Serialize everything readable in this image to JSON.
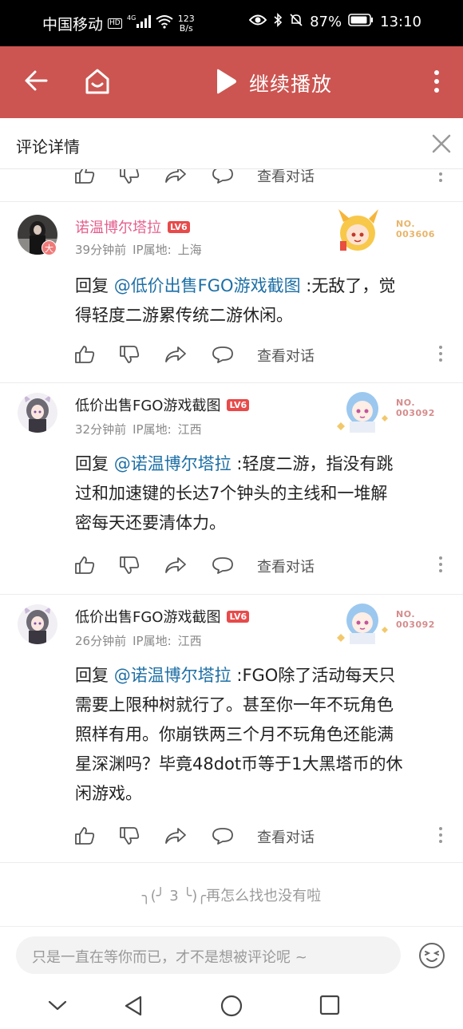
{
  "status_bar": {
    "carrier": "中国移动",
    "hd": "HD",
    "network": "4G",
    "speed_value": "123",
    "speed_unit": "B/s",
    "battery": "87%",
    "time": "13:10"
  },
  "app_bar": {
    "play_label": "继续播放"
  },
  "title_bar": {
    "title": "评论详情"
  },
  "action_label": "查看对话",
  "comments": [
    {
      "user": "诺温博尔塔拉",
      "level": "LV6",
      "badge": "大",
      "time": "39分钟前",
      "ip_label": "IP属地:",
      "ip": "上海",
      "deco_no": "NO.",
      "deco_num": "003606",
      "reply_prefix": "回复",
      "mention": "@低价出售FGO游戏截图",
      "text_line1": " :无敌了，觉",
      "text_lines": [
        "得轻度二游累传统二游休闲。"
      ]
    },
    {
      "user": "低价出售FGO游戏截图",
      "level": "LV6",
      "time": "32分钟前",
      "ip_label": "IP属地:",
      "ip": "江西",
      "deco_no": "NO.",
      "deco_num": "003092",
      "reply_prefix": "回复",
      "mention": "@诺温博尔塔拉",
      "text_line1": " :轻度二游，指没有跳",
      "text_lines": [
        "过和加速键的长达7个钟头的主线和一堆解",
        "密每天还要清体力。"
      ]
    },
    {
      "user": "低价出售FGO游戏截图",
      "level": "LV6",
      "time": "26分钟前",
      "ip_label": "IP属地:",
      "ip": "江西",
      "deco_no": "NO.",
      "deco_num": "003092",
      "reply_prefix": "回复",
      "mention": "@诺温博尔塔拉",
      "text_line1": " :FGO除了活动每天只",
      "text_lines": [
        "需要上限种树就行了。甚至你一年不玩角色",
        "照样有用。你崩铁两三个月不玩角色还能满",
        "星深渊吗？毕竟48dot币等于1大黑塔币的休",
        "闲游戏。"
      ]
    }
  ],
  "end_note": "╮(╯ 3 ╰)╭再怎么找也没有啦",
  "input": {
    "placeholder": "只是一直在等你而已，才不是想被评论呢 ~"
  },
  "colors": {
    "app_bar": "#cc5551",
    "mention": "#1d6fa5",
    "vip_name": "#e45f8e",
    "level_badge": "#e84a4a"
  }
}
